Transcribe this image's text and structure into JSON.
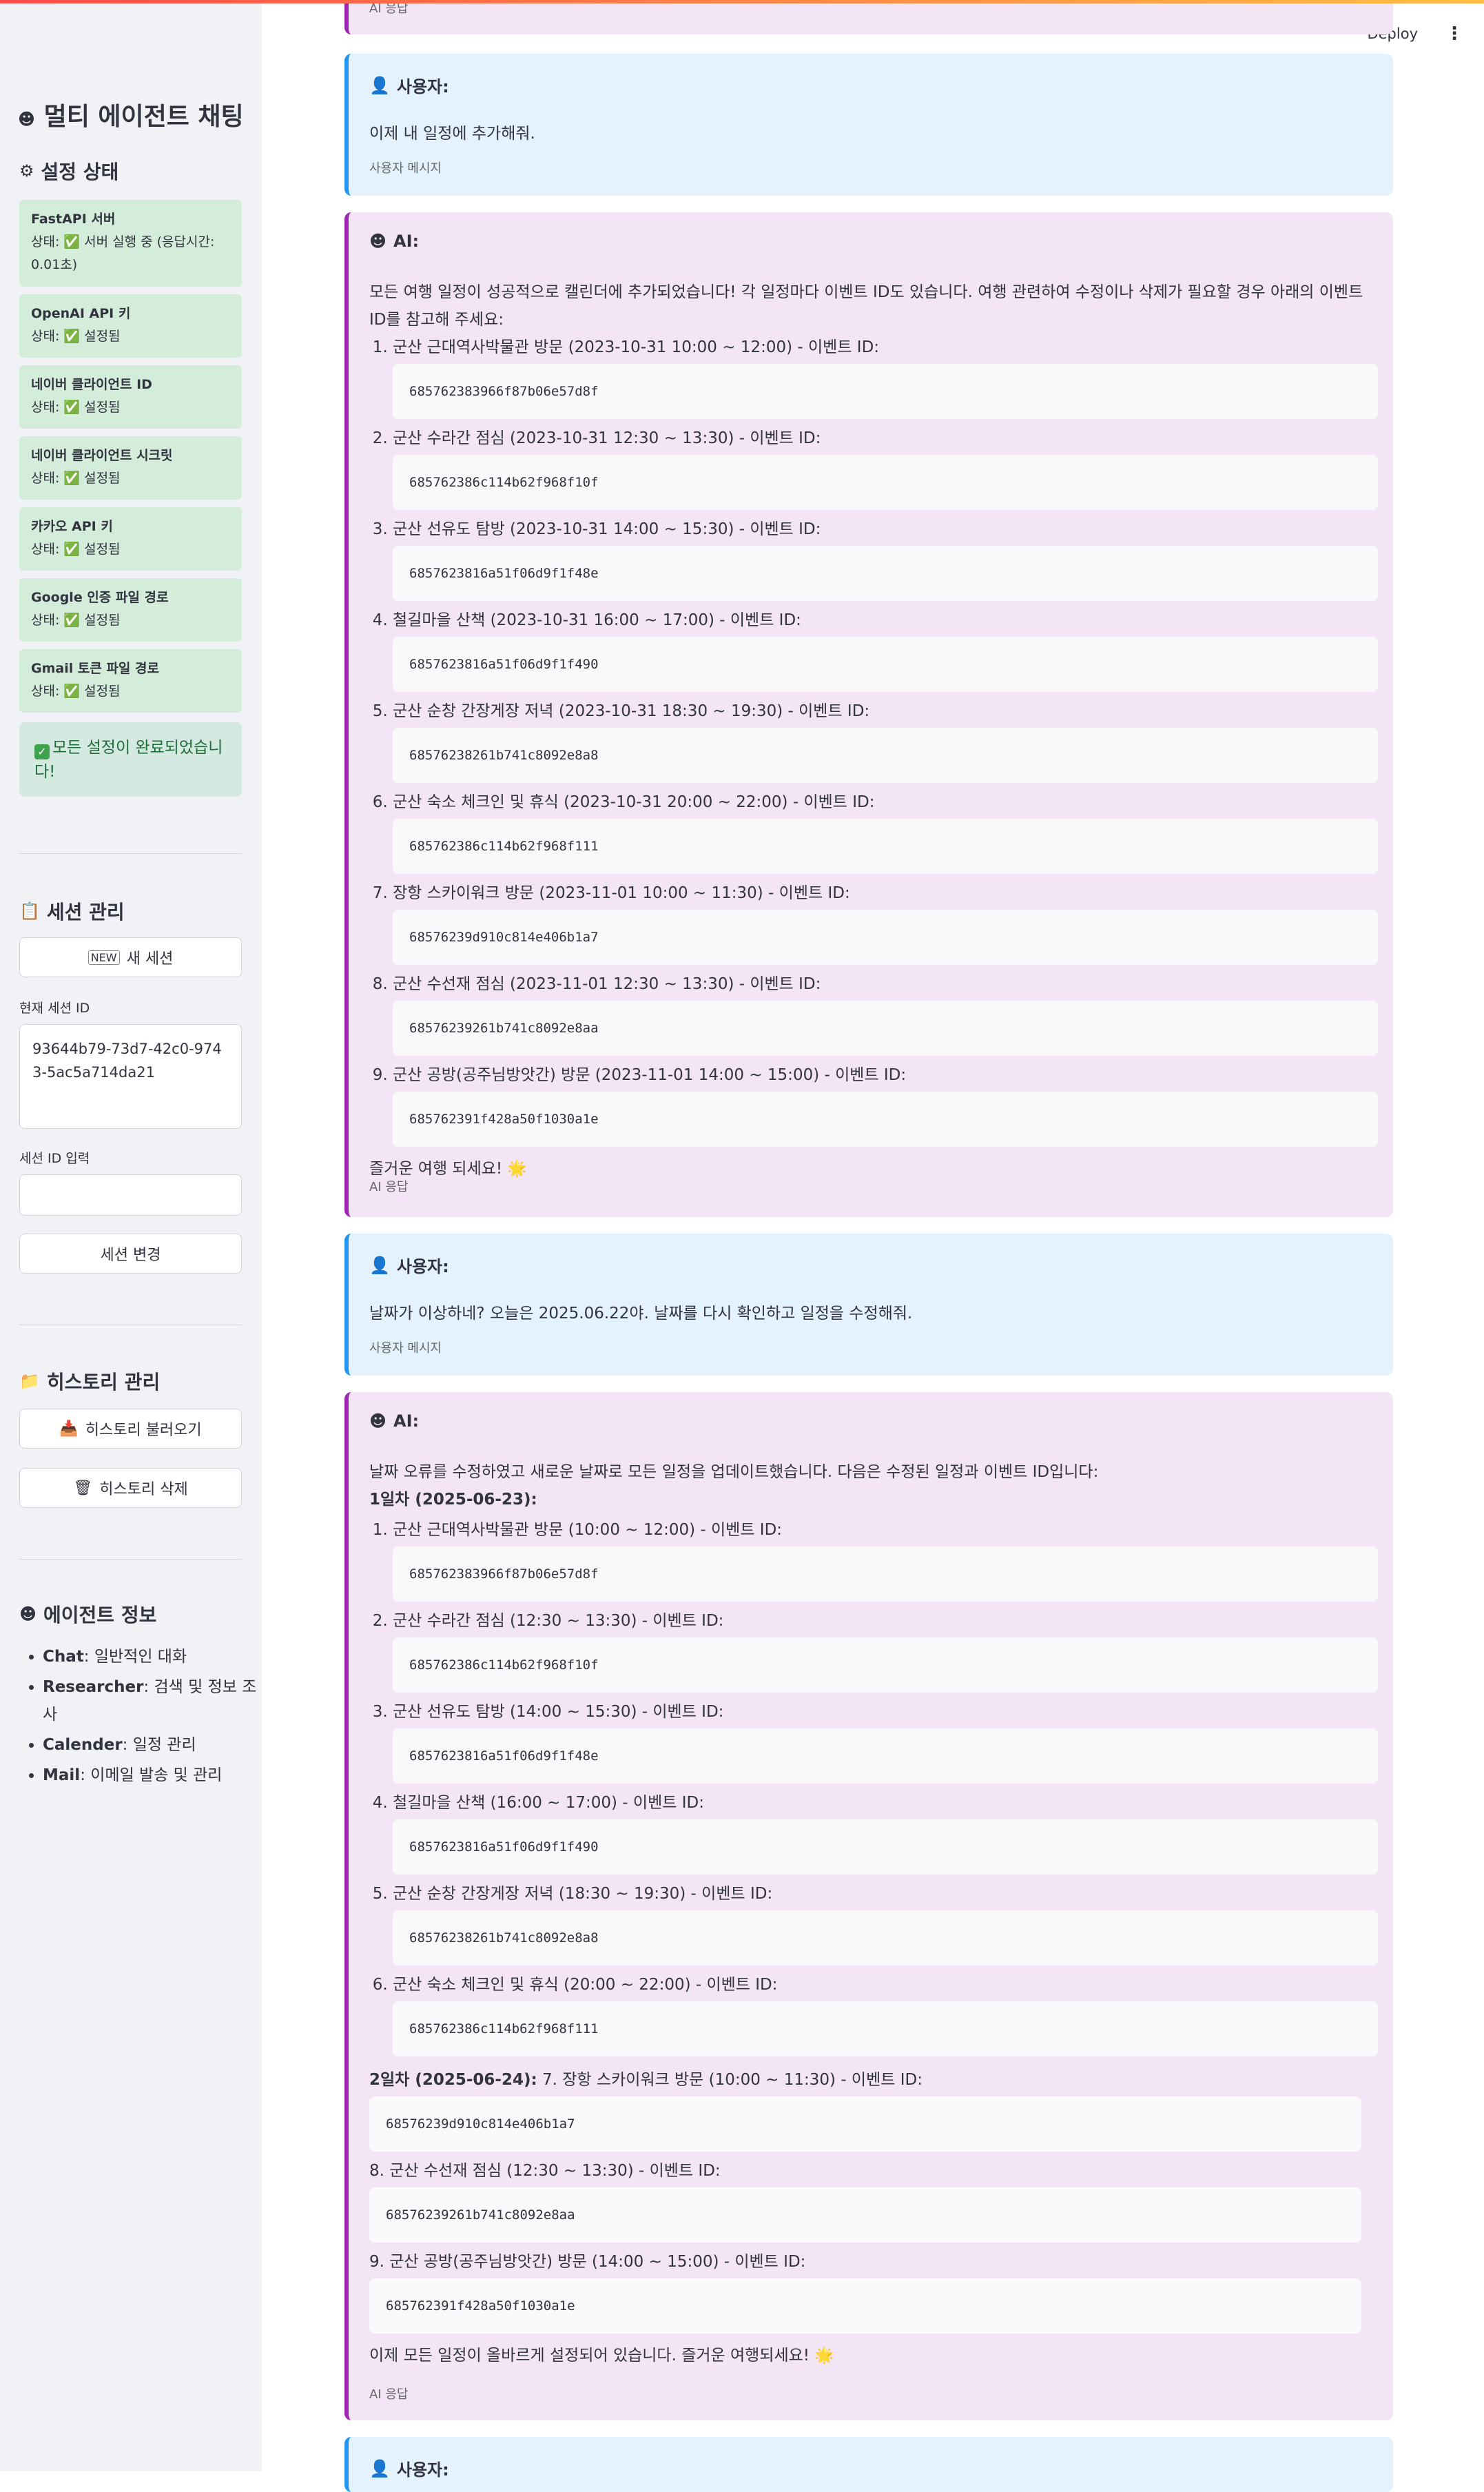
{
  "header": {
    "deploy_label": "Deploy",
    "menu_icon": "kebab-menu-icon"
  },
  "sidebar": {
    "app_icon": "robot-icon",
    "title": "멀티 에이전트 채팅",
    "settings_title": "설정 상태",
    "status_items": [
      {
        "name": "FastAPI 서버",
        "status": "상태: ✅ 서버 실행 중 (응답시간: 0.01초)"
      },
      {
        "name": "OpenAI API 키",
        "status": "상태: ✅ 설정됨"
      },
      {
        "name": "네이버 클라이언트 ID",
        "status": "상태: ✅ 설정됨"
      },
      {
        "name": "네이버 클라이언트 시크릿",
        "status": "상태: ✅ 설정됨"
      },
      {
        "name": "카카오 API 키",
        "status": "상태: ✅ 설정됨"
      },
      {
        "name": "Google 인증 파일 경로",
        "status": "상태: ✅ 설정됨"
      },
      {
        "name": "Gmail 토큰 파일 경로",
        "status": "상태: ✅ 설정됨"
      }
    ],
    "all_set_message": "모든 설정이 완료되었습니다!",
    "session_title": "세션 관리",
    "new_session_label": "새 세션",
    "current_session_label": "현재 세션 ID",
    "current_session_value": "93644b79-73d7-42c0-9743-5ac5a714da21",
    "session_input_label": "세션 ID 입력",
    "session_input_value": "",
    "change_session_label": "세션 변경",
    "history_title": "히스토리 관리",
    "load_history_label": "히스토리 불러오기",
    "delete_history_label": "히스토리 삭제",
    "agent_info_title": "에이전트 정보",
    "agents": [
      {
        "name": "Chat",
        "desc": ": 일반적인 대화"
      },
      {
        "name": "Researcher",
        "desc": ": 검색 및 정보 조사"
      },
      {
        "name": "Calender",
        "desc": ": 일정 관리"
      },
      {
        "name": "Mail",
        "desc": ": 이메일 발송 및 관리"
      }
    ]
  },
  "chat": {
    "top_caption": "AI 응답",
    "user_role": "사용자:",
    "ai_role": "AI:",
    "user_caption": "사용자 메시지",
    "ai_caption": "AI 응답",
    "msg1": {
      "text": "이제 내 일정에 추가해줘."
    },
    "msg2": {
      "intro": "모든 여행 일정이 성공적으로 캘린더에 추가되었습니다! 각 일정마다 이벤트 ID도 있습니다. 여행 관련하여 수정이나 삭제가 필요할 경우 아래의 이벤트 ID를 참고해 주세요:",
      "items": [
        {
          "text": "군산 근대역사박물관 방문 (2023-10-31 10:00 ~ 12:00) - 이벤트 ID:",
          "id": "685762383966f87b06e57d8f"
        },
        {
          "text": "군산 수라간 점심 (2023-10-31 12:30 ~ 13:30) - 이벤트 ID:",
          "id": "685762386c114b62f968f10f"
        },
        {
          "text": "군산 선유도 탐방 (2023-10-31 14:00 ~ 15:30) - 이벤트 ID:",
          "id": "6857623816a51f06d9f1f48e"
        },
        {
          "text": "철길마을 산책 (2023-10-31 16:00 ~ 17:00) - 이벤트 ID:",
          "id": "6857623816a51f06d9f1f490"
        },
        {
          "text": "군산 순창 간장게장 저녁 (2023-10-31 18:30 ~ 19:30) - 이벤트 ID:",
          "id": "68576238261b741c8092e8a8"
        },
        {
          "text": "군산 숙소 체크인 및 휴식 (2023-10-31 20:00 ~ 22:00) - 이벤트 ID:",
          "id": "685762386c114b62f968f111"
        },
        {
          "text": "장항 스카이워크 방문 (2023-11-01 10:00 ~ 11:30) - 이벤트 ID:",
          "id": "68576239d910c814e406b1a7"
        },
        {
          "text": "군산 수선재 점심 (2023-11-01 12:30 ~ 13:30) - 이벤트 ID:",
          "id": "68576239261b741c8092e8aa"
        },
        {
          "text": "군산 공방(공주님방앗간) 방문 (2023-11-01 14:00 ~ 15:00) - 이벤트 ID:",
          "id": "685762391f428a50f1030a1e"
        }
      ],
      "outro": "즐거운 여행 되세요! 🌟"
    },
    "msg3": {
      "text": "날짜가 이상하네? 오늘은 2025.06.22야. 날짜를 다시 확인하고 일정을 수정해줘."
    },
    "msg4": {
      "intro": "날짜 오류를 수정하였고 새로운 날짜로 모든 일정을 업데이트했습니다. 다음은 수정된 일정과 이벤트 ID입니다:",
      "day1": "1일차 (2025-06-23):",
      "items": [
        {
          "text": "군산 근대역사박물관 방문 (10:00 ~ 12:00) - 이벤트 ID:",
          "id": "685762383966f87b06e57d8f"
        },
        {
          "text": "군산 수라간 점심 (12:30 ~ 13:30) - 이벤트 ID:",
          "id": "685762386c114b62f968f10f"
        },
        {
          "text": "군산 선유도 탐방 (14:00 ~ 15:30) - 이벤트 ID:",
          "id": "6857623816a51f06d9f1f48e"
        },
        {
          "text": "철길마을 산책 (16:00 ~ 17:00) - 이벤트 ID:",
          "id": "6857623816a51f06d9f1f490"
        },
        {
          "text": "군산 순창 간장게장 저녁 (18:30 ~ 19:30) - 이벤트 ID:",
          "id": "68576238261b741c8092e8a8"
        },
        {
          "text": "군산 숙소 체크인 및 휴식 (20:00 ~ 22:00) - 이벤트 ID:",
          "id": "685762386c114b62f968f111"
        }
      ],
      "day2": "2일차 (2025-06-24):",
      "day2_first": " 7. 장항 스카이워크 방문 (10:00 ~ 11:30) - 이벤트 ID:",
      "day2_first_id": "68576239d910c814e406b1a7",
      "day2_item8": "8. 군산 수선재 점심 (12:30 ~ 13:30) - 이벤트 ID:",
      "day2_item8_id": "68576239261b741c8092e8aa",
      "day2_item9": "9. 군산 공방(공주님방앗간) 방문 (14:00 ~ 15:00) - 이벤트 ID:",
      "day2_item9_id": "685762391f428a50f1030a1e",
      "outro": "이제 모든 일정이 올바르게 설정되어 있습니다. 즐거운 여행되세요! 🌟"
    }
  }
}
